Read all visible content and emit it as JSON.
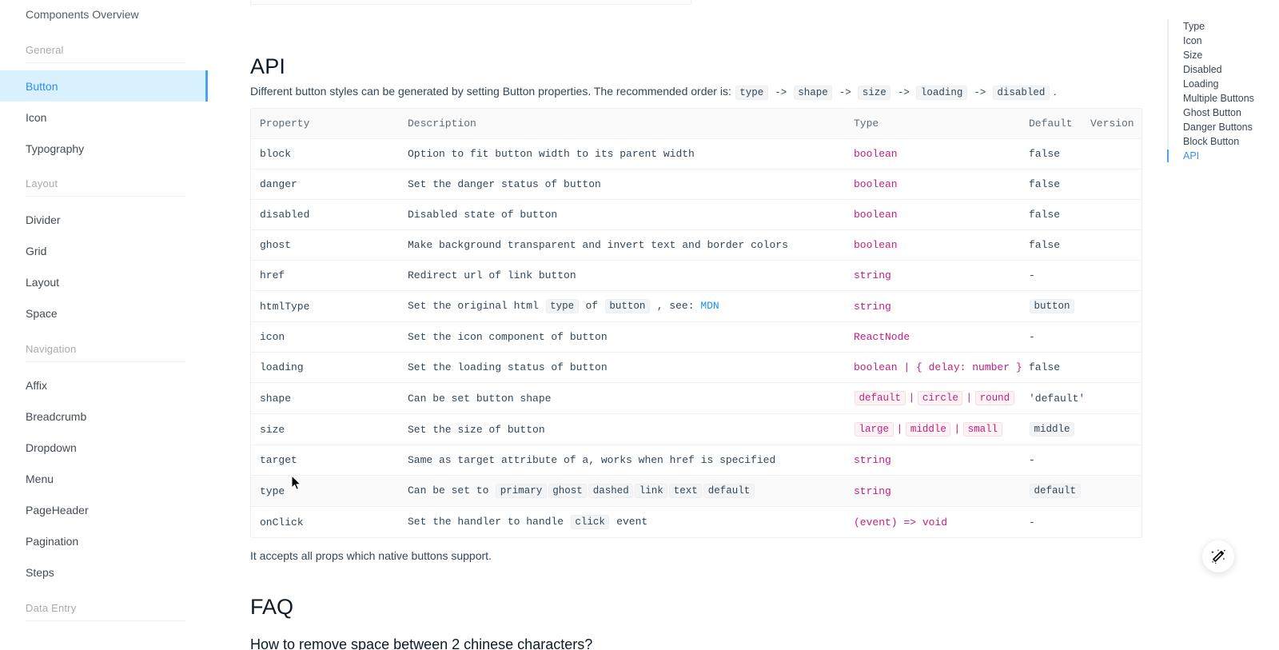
{
  "sidebar": {
    "overview_label": "Components Overview",
    "groups": [
      {
        "label": "General",
        "items": [
          {
            "label": "Button",
            "active": true
          },
          {
            "label": "Icon",
            "active": false
          },
          {
            "label": "Typography",
            "active": false
          }
        ]
      },
      {
        "label": "Layout",
        "items": [
          {
            "label": "Divider",
            "active": false
          },
          {
            "label": "Grid",
            "active": false
          },
          {
            "label": "Layout",
            "active": false
          },
          {
            "label": "Space",
            "active": false
          }
        ]
      },
      {
        "label": "Navigation",
        "items": [
          {
            "label": "Affix",
            "active": false
          },
          {
            "label": "Breadcrumb",
            "active": false
          },
          {
            "label": "Dropdown",
            "active": false
          },
          {
            "label": "Menu",
            "active": false
          },
          {
            "label": "PageHeader",
            "active": false
          },
          {
            "label": "Pagination",
            "active": false
          },
          {
            "label": "Steps",
            "active": false
          }
        ]
      },
      {
        "label": "Data Entry",
        "items": []
      }
    ]
  },
  "toc": {
    "items": [
      {
        "label": "Type",
        "active": false
      },
      {
        "label": "Icon",
        "active": false
      },
      {
        "label": "Size",
        "active": false
      },
      {
        "label": "Disabled",
        "active": false
      },
      {
        "label": "Loading",
        "active": false
      },
      {
        "label": "Multiple Buttons",
        "active": false
      },
      {
        "label": "Ghost Button",
        "active": false
      },
      {
        "label": "Danger Buttons",
        "active": false
      },
      {
        "label": "Block Button",
        "active": false
      },
      {
        "label": "API",
        "active": true
      }
    ]
  },
  "main": {
    "api_heading": "API",
    "api_intro_prefix": "Different button styles can be generated by setting Button properties. The recommended order is:",
    "api_intro_tags": [
      "type",
      "shape",
      "size",
      "loading",
      "disabled"
    ],
    "api_intro_arrow": "->",
    "api_intro_suffix": ".",
    "note": "It accepts all props which native buttons support.",
    "faq_heading": "FAQ",
    "faq_question": "How to remove space between 2 chinese characters?"
  },
  "table": {
    "headers": [
      "Property",
      "Description",
      "Type",
      "Default",
      "Version"
    ],
    "rows": [
      {
        "property": "block",
        "description": [
          {
            "t": "text",
            "v": "Option to fit button width to its parent width"
          }
        ],
        "type": [
          {
            "t": "plain",
            "v": "boolean"
          }
        ],
        "default": [
          {
            "t": "text",
            "v": "false"
          }
        ],
        "version": "",
        "hover": false
      },
      {
        "property": "danger",
        "description": [
          {
            "t": "text",
            "v": "Set the danger status of button"
          }
        ],
        "type": [
          {
            "t": "plain",
            "v": "boolean"
          }
        ],
        "default": [
          {
            "t": "text",
            "v": "false"
          }
        ],
        "version": "",
        "hover": false
      },
      {
        "property": "disabled",
        "description": [
          {
            "t": "text",
            "v": "Disabled state of button"
          }
        ],
        "type": [
          {
            "t": "plain",
            "v": "boolean"
          }
        ],
        "default": [
          {
            "t": "text",
            "v": "false"
          }
        ],
        "version": "",
        "hover": false
      },
      {
        "property": "ghost",
        "description": [
          {
            "t": "text",
            "v": "Make background transparent and invert text and border colors"
          }
        ],
        "type": [
          {
            "t": "plain",
            "v": "boolean"
          }
        ],
        "default": [
          {
            "t": "text",
            "v": "false"
          }
        ],
        "version": "",
        "hover": false
      },
      {
        "property": "href",
        "description": [
          {
            "t": "text",
            "v": "Redirect url of link button"
          }
        ],
        "type": [
          {
            "t": "plain",
            "v": "string"
          }
        ],
        "default": [
          {
            "t": "text",
            "v": "-"
          }
        ],
        "version": "",
        "hover": false
      },
      {
        "property": "htmlType",
        "description": [
          {
            "t": "text",
            "v": "Set the original html "
          },
          {
            "t": "code",
            "v": "type"
          },
          {
            "t": "text",
            "v": " of "
          },
          {
            "t": "code",
            "v": "button"
          },
          {
            "t": "text",
            "v": " , see: "
          },
          {
            "t": "link",
            "v": "MDN"
          }
        ],
        "type": [
          {
            "t": "plain",
            "v": "string"
          }
        ],
        "default": [
          {
            "t": "code",
            "v": "button"
          }
        ],
        "version": "",
        "hover": false
      },
      {
        "property": "icon",
        "description": [
          {
            "t": "text",
            "v": "Set the icon component of button"
          }
        ],
        "type": [
          {
            "t": "plain",
            "v": "ReactNode"
          }
        ],
        "default": [
          {
            "t": "text",
            "v": "-"
          }
        ],
        "version": "",
        "hover": false
      },
      {
        "property": "loading",
        "description": [
          {
            "t": "text",
            "v": "Set the loading status of button"
          }
        ],
        "type": [
          {
            "t": "plain",
            "v": "boolean | { delay: number }"
          }
        ],
        "default": [
          {
            "t": "text",
            "v": "false"
          }
        ],
        "version": "",
        "hover": false
      },
      {
        "property": "shape",
        "description": [
          {
            "t": "text",
            "v": "Can be set button shape"
          }
        ],
        "type": [
          {
            "t": "pink",
            "v": "default"
          },
          {
            "t": "sep",
            "v": "|"
          },
          {
            "t": "pink",
            "v": "circle"
          },
          {
            "t": "sep",
            "v": "|"
          },
          {
            "t": "pink",
            "v": "round"
          }
        ],
        "default": [
          {
            "t": "text",
            "v": "'default'"
          }
        ],
        "version": "",
        "hover": false
      },
      {
        "property": "size",
        "description": [
          {
            "t": "text",
            "v": "Set the size of button"
          }
        ],
        "type": [
          {
            "t": "pink",
            "v": "large"
          },
          {
            "t": "sep",
            "v": "|"
          },
          {
            "t": "pink",
            "v": "middle"
          },
          {
            "t": "sep",
            "v": "|"
          },
          {
            "t": "pink",
            "v": "small"
          }
        ],
        "default": [
          {
            "t": "code",
            "v": "middle"
          }
        ],
        "version": "",
        "hover": false
      },
      {
        "property": "target",
        "description": [
          {
            "t": "text",
            "v": "Same as target attribute of a, works when href is specified"
          }
        ],
        "type": [
          {
            "t": "plain",
            "v": "string"
          }
        ],
        "default": [
          {
            "t": "text",
            "v": "-"
          }
        ],
        "version": "",
        "hover": false
      },
      {
        "property": "type",
        "description": [
          {
            "t": "text",
            "v": "Can be set to "
          },
          {
            "t": "code",
            "v": "primary"
          },
          {
            "t": "code",
            "v": "ghost"
          },
          {
            "t": "code",
            "v": "dashed"
          },
          {
            "t": "code",
            "v": "link"
          },
          {
            "t": "code",
            "v": "text"
          },
          {
            "t": "code",
            "v": "default"
          }
        ],
        "type": [
          {
            "t": "plain",
            "v": "string"
          }
        ],
        "default": [
          {
            "t": "code",
            "v": "default"
          }
        ],
        "version": "",
        "hover": true
      },
      {
        "property": "onClick",
        "description": [
          {
            "t": "text",
            "v": "Set the handler to handle "
          },
          {
            "t": "code",
            "v": "click"
          },
          {
            "t": "text",
            "v": " event"
          }
        ],
        "type": [
          {
            "t": "plain",
            "v": "(event) => void"
          }
        ],
        "default": [
          {
            "t": "text",
            "v": "-"
          }
        ],
        "version": "",
        "hover": false
      }
    ]
  },
  "fab": {
    "icon": "magic-wand-icon"
  },
  "colors": {
    "accent": "#1890ff",
    "active_sidebar_bg": "#d9f0ff",
    "type_pink": "#c41d7f",
    "link": "#1890ff",
    "heading": "#0d1a26",
    "body_text": "#314659"
  }
}
